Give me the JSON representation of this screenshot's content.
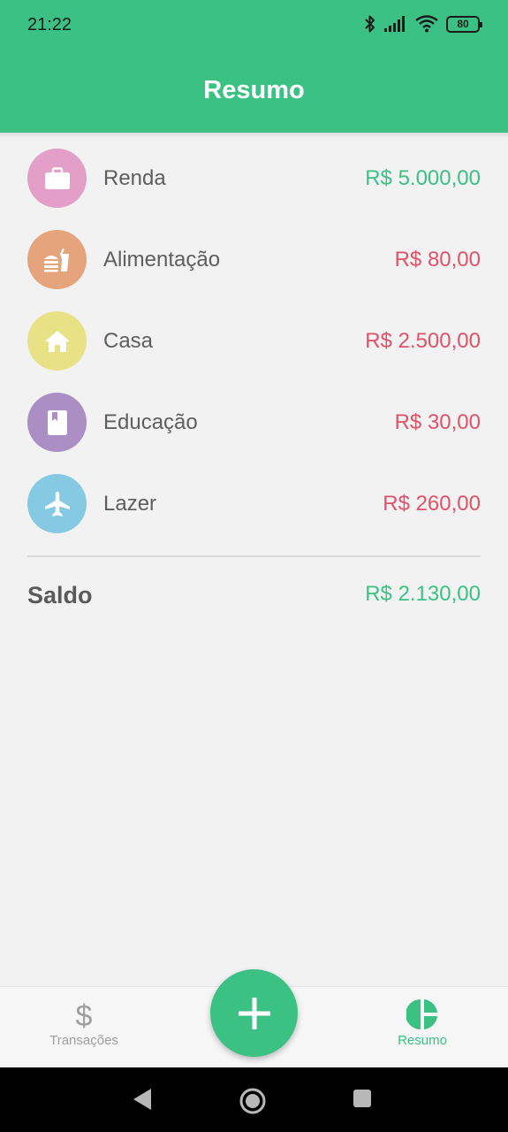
{
  "status_bar": {
    "time": "21:22",
    "battery": "80",
    "icons": [
      "bluetooth-icon",
      "signal-icon",
      "wifi-icon",
      "battery-icon"
    ]
  },
  "header": {
    "title": "Resumo"
  },
  "categories": [
    {
      "label": "Renda",
      "amount": "R$ 5.000,00",
      "icon": "briefcase-icon",
      "icon_color": "#e39fc8",
      "amount_color": "#3cc184"
    },
    {
      "label": "Alimentação",
      "amount": "R$ 80,00",
      "icon": "fastfood-icon",
      "icon_color": "#e5a47c",
      "amount_color": "#e05268"
    },
    {
      "label": "Casa",
      "amount": "R$ 2.500,00",
      "icon": "home-icon",
      "icon_color": "#e8e185",
      "amount_color": "#e05268"
    },
    {
      "label": "Educação",
      "amount": "R$ 30,00",
      "icon": "book-icon",
      "icon_color": "#ab8ec4",
      "amount_color": "#e05268"
    },
    {
      "label": "Lazer",
      "amount": "R$ 260,00",
      "icon": "airplane-icon",
      "icon_color": "#85c9e3",
      "amount_color": "#e05268"
    }
  ],
  "summary": {
    "label": "Saldo",
    "value": "R$ 2.130,00"
  },
  "bottom_nav": {
    "items": [
      {
        "label": "Transações",
        "icon": "dollar-icon",
        "active": false
      },
      {
        "label": "Resumo",
        "icon": "pie-chart-icon",
        "active": true
      }
    ],
    "fab_icon": "plus-icon"
  },
  "colors": {
    "primary": "#3cc184",
    "negative": "#e05268",
    "background": "#f2f2f2"
  }
}
